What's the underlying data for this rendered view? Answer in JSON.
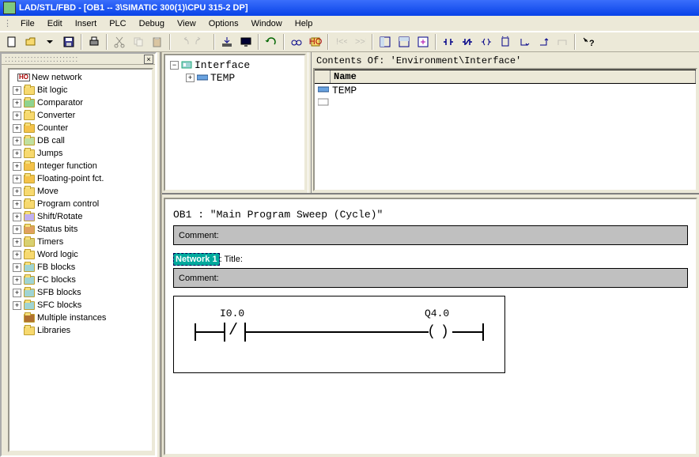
{
  "title": "LAD/STL/FBD  - [OB1 -- 3\\SIMATIC 300(1)\\CPU 315-2 DP]",
  "menu": {
    "file": "File",
    "edit": "Edit",
    "insert": "Insert",
    "plc": "PLC",
    "debug": "Debug",
    "view": "View",
    "options": "Options",
    "window": "Window",
    "help": "Help"
  },
  "tree": {
    "new_network": "New network",
    "items": [
      "Bit logic",
      "Comparator",
      "Converter",
      "Counter",
      "DB call",
      "Jumps",
      "Integer function",
      "Floating-point fct.",
      "Move",
      "Program control",
      "Shift/Rotate",
      "Status bits",
      "Timers",
      "Word logic",
      "FB blocks",
      "FC blocks",
      "SFB blocks",
      "SFC blocks",
      "Multiple instances",
      "Libraries"
    ]
  },
  "interface": {
    "root": "Interface",
    "temp": "TEMP",
    "contents_header": "Contents Of: 'Environment\\Interface'",
    "name_col": "Name",
    "row_temp": "TEMP"
  },
  "ladder": {
    "block_title": "OB1 :  \"Main Program Sweep (Cycle)\"",
    "comment_label": "Comment:",
    "network_label": "Network 1",
    "title_label": ": Title:",
    "input": "I0.0",
    "output": "Q4.0"
  }
}
